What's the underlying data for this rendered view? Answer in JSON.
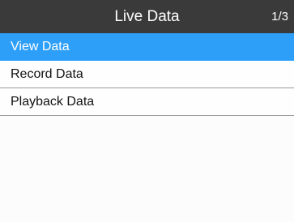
{
  "header": {
    "title": "Live Data",
    "page_indicator": "1/3"
  },
  "menu": {
    "selected_index": 0,
    "items": [
      {
        "label": "View Data"
      },
      {
        "label": "Record Data"
      },
      {
        "label": "Playback Data"
      }
    ]
  },
  "colors": {
    "header_bg": "#3a3a3a",
    "selected_bg": "#2e9ff8",
    "divider": "#9a9a9a"
  }
}
